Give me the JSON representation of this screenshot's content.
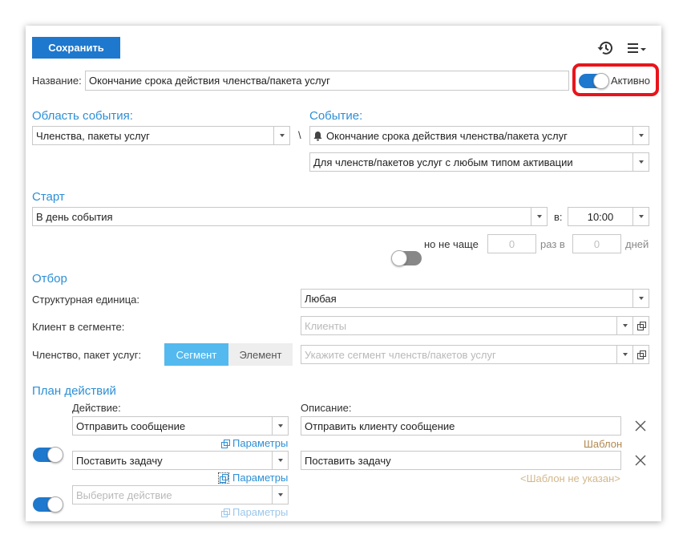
{
  "toolbar": {
    "save_label": "Сохранить",
    "history_icon": "history-icon",
    "menu_icon": "menu-icon"
  },
  "name_row": {
    "label": "Название:",
    "value": "Окончание срока действия членства/пакета услуг",
    "active_label": "Активно",
    "active": true,
    "highlight_color": "#e8151b"
  },
  "event_area": {
    "title": "Область события:",
    "value": "Членства, пакеты услуг",
    "separator": "\\"
  },
  "event": {
    "title": "Событие:",
    "value": "Окончание срока действия членства/пакета услуг",
    "icon": "bell-icon",
    "sub_value": "Для членств/пакетов услуг с любым типом активации"
  },
  "start": {
    "title": "Старт",
    "value": "В день события",
    "at_label": "в:",
    "time": "10:00",
    "limit_label": "но не чаще",
    "times_value": "0",
    "times_label": "раз в",
    "days_value": "0",
    "days_label": "дней",
    "limit_enabled": false
  },
  "filter": {
    "title": "Отбор",
    "unit_label": "Структурная единица:",
    "unit_value": "Любая",
    "client_label": "Клиент в сегменте:",
    "client_placeholder": "Клиенты",
    "membership_label": "Членство, пакет услуг:",
    "segment_tab": "Сегмент",
    "element_tab": "Элемент",
    "membership_placeholder": "Укажите сегмент членств/пакетов услуг"
  },
  "plan": {
    "title": "План действий",
    "action_header": "Действие:",
    "description_header": "Описание:",
    "params_label": "Параметры",
    "actions": [
      {
        "action": "Отправить сообщение",
        "description": "Отправить клиенту сообщение",
        "template": "Шаблон",
        "enabled": true
      },
      {
        "action": "Поставить задачу",
        "description": "Поставить задачу",
        "template": "<Шаблон не указан>",
        "enabled": true
      }
    ],
    "new_action_placeholder": "Выберите действие"
  }
}
